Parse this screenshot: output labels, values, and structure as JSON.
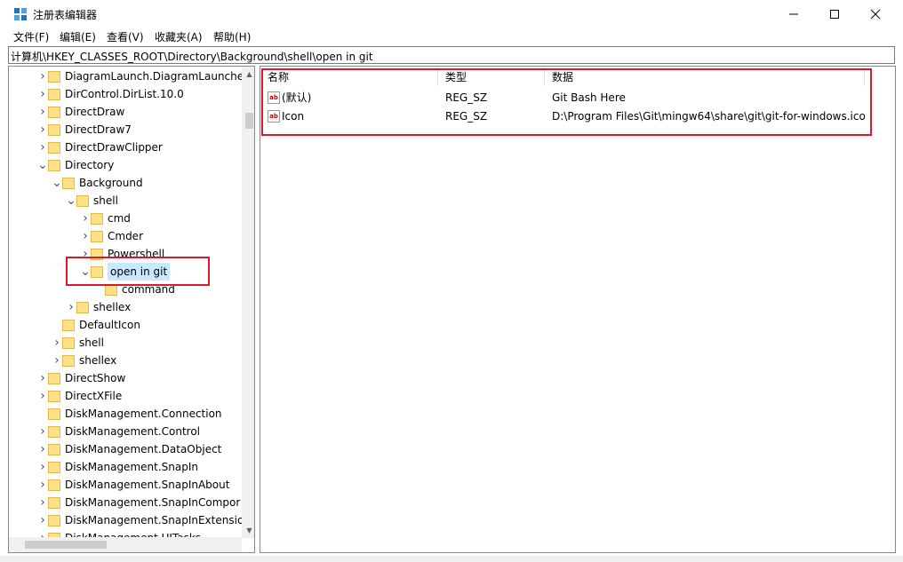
{
  "window": {
    "title": "注册表编辑器"
  },
  "menu": [
    "文件(F)",
    "编辑(E)",
    "查看(V)",
    "收藏夹(A)",
    "帮助(H)"
  ],
  "address": "计算机\\HKEY_CLASSES_ROOT\\Directory\\Background\\shell\\open in git",
  "tree": [
    {
      "label": "DiagramLaunch.DiagramLauncher",
      "chevron": "right"
    },
    {
      "label": "DirControl.DirList.10.0",
      "chevron": "right"
    },
    {
      "label": "DirectDraw",
      "chevron": "right"
    },
    {
      "label": "DirectDraw7",
      "chevron": "right"
    },
    {
      "label": "DirectDrawClipper",
      "chevron": "right"
    },
    {
      "label": "Directory",
      "chevron": "down"
    },
    {
      "label": "Background",
      "chevron": "down"
    },
    {
      "label": "shell",
      "chevron": "down"
    },
    {
      "label": "cmd",
      "chevron": "right"
    },
    {
      "label": "Cmder",
      "chevron": "right"
    },
    {
      "label": "Powershell",
      "chevron": "right"
    },
    {
      "label": "open in git",
      "chevron": "down"
    },
    {
      "label": "command",
      "chevron": "none"
    },
    {
      "label": "shellex",
      "chevron": "right"
    },
    {
      "label": "DefaultIcon",
      "chevron": "none"
    },
    {
      "label": "shell",
      "chevron": "right"
    },
    {
      "label": "shellex",
      "chevron": "right"
    },
    {
      "label": "DirectShow",
      "chevron": "right"
    },
    {
      "label": "DirectXFile",
      "chevron": "right"
    },
    {
      "label": "DiskManagement.Connection",
      "chevron": "none"
    },
    {
      "label": "DiskManagement.Control",
      "chevron": "right"
    },
    {
      "label": "DiskManagement.DataObject",
      "chevron": "right"
    },
    {
      "label": "DiskManagement.SnapIn",
      "chevron": "right"
    },
    {
      "label": "DiskManagement.SnapInAbout",
      "chevron": "right"
    },
    {
      "label": "DiskManagement.SnapInCompor",
      "chevron": "right"
    },
    {
      "label": "DiskManagement.SnapInExtensio",
      "chevron": "right"
    },
    {
      "label": "DiskManagement.UITasks",
      "chevron": "right"
    }
  ],
  "list": {
    "headers": [
      "名称",
      "类型",
      "数据"
    ],
    "rows": [
      {
        "name": "(默认)",
        "type": "REG_SZ",
        "data": "Git Bash Here",
        "icon": "ab"
      },
      {
        "name": "Icon",
        "type": "REG_SZ",
        "data": "D:\\Program Files\\Git\\mingw64\\share\\git\\git-for-windows.ico",
        "icon": "ab"
      }
    ]
  },
  "colors": {
    "highlight": "#e0162b",
    "selection": "#cce8ff"
  }
}
